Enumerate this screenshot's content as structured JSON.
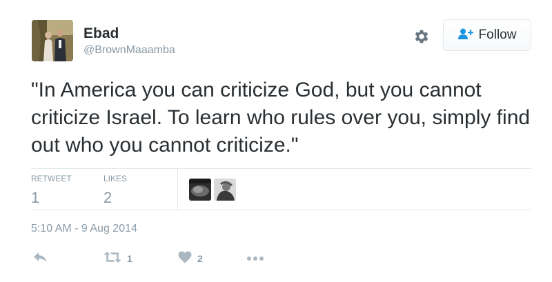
{
  "user": {
    "display_name": "Ebad",
    "screen_name": "@BrownMaaamba"
  },
  "follow_button": {
    "label": "Follow",
    "icon": "person-add-icon"
  },
  "tweet": {
    "text": "\"In America you can criticize God, but you cannot criticize Israel. To learn who rules over you, simply find out who you cannot criticize.\"",
    "timestamp": "5:10 AM - 9 Aug 2014"
  },
  "stats": {
    "retweets_label": "RETWEET",
    "retweets_value": "1",
    "likes_label": "LIKES",
    "likes_value": "2"
  },
  "actions": {
    "reply_icon": "reply-icon",
    "retweet_icon": "retweet-icon",
    "retweet_count": "1",
    "like_icon": "heart-icon",
    "like_count": "2",
    "more_icon": "more-dots-icon"
  },
  "colors": {
    "text": "#292f33",
    "muted": "#8899a6",
    "border": "#e1e8ed",
    "accent": "#1b95e0"
  }
}
